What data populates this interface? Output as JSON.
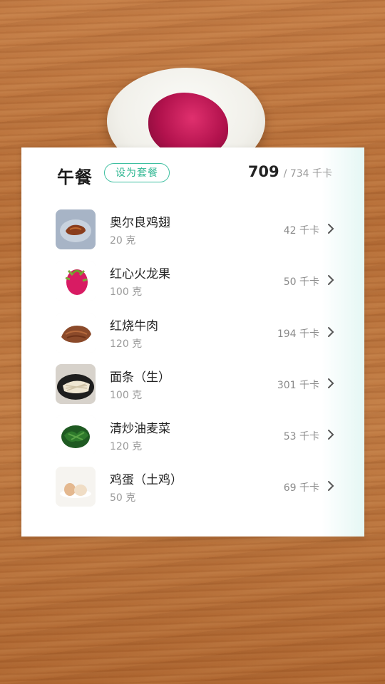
{
  "meal": {
    "title": "午餐",
    "set_button_label": "设为套餐",
    "calories_current": "709",
    "calories_total_text": "/ 734 千卡"
  },
  "items": [
    {
      "name": "奥尔良鸡翅",
      "amount": "20 克",
      "calories": "42 千卡",
      "icon": "chicken-wing-icon"
    },
    {
      "name": "红心火龙果",
      "amount": "100 克",
      "calories": "50 千卡",
      "icon": "dragon-fruit-icon"
    },
    {
      "name": "红烧牛肉",
      "amount": "120 克",
      "calories": "194 千卡",
      "icon": "braised-beef-icon"
    },
    {
      "name": "面条（生）",
      "amount": "100 克",
      "calories": "301 千卡",
      "icon": "noodles-icon"
    },
    {
      "name": "清炒油麦菜",
      "amount": "120 克",
      "calories": "53 千卡",
      "icon": "stir-fried-lettuce-icon"
    },
    {
      "name": "鸡蛋（土鸡）",
      "amount": "50 克",
      "calories": "69 千卡",
      "icon": "egg-icon"
    }
  ],
  "colors": {
    "accent": "#3dbfa0",
    "table": "#b9713a"
  }
}
